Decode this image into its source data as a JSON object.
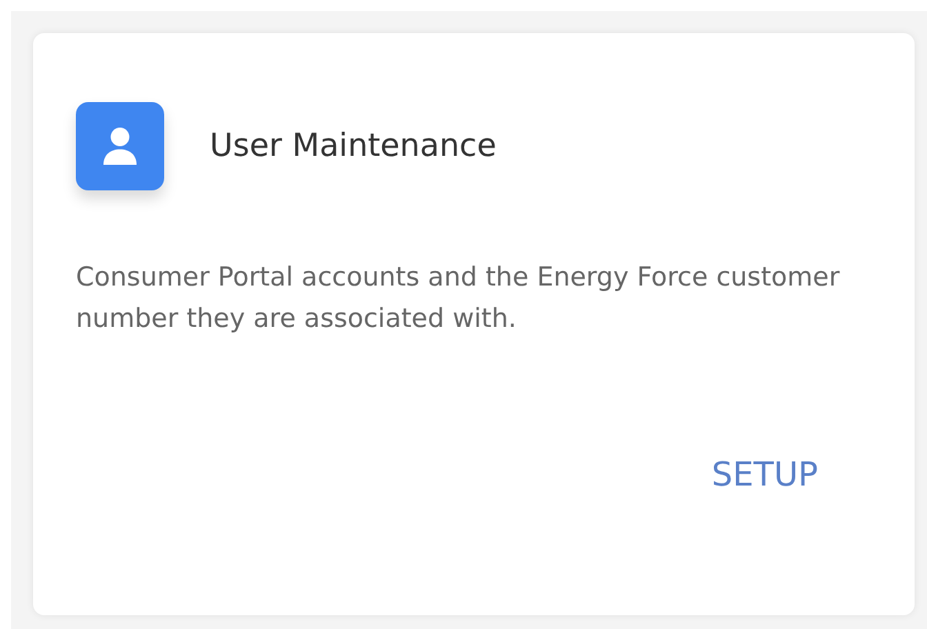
{
  "card": {
    "title": "User Maintenance",
    "description": "Consumer Portal accounts and the Energy Force customer number they are associated with.",
    "action": "SETUP"
  }
}
